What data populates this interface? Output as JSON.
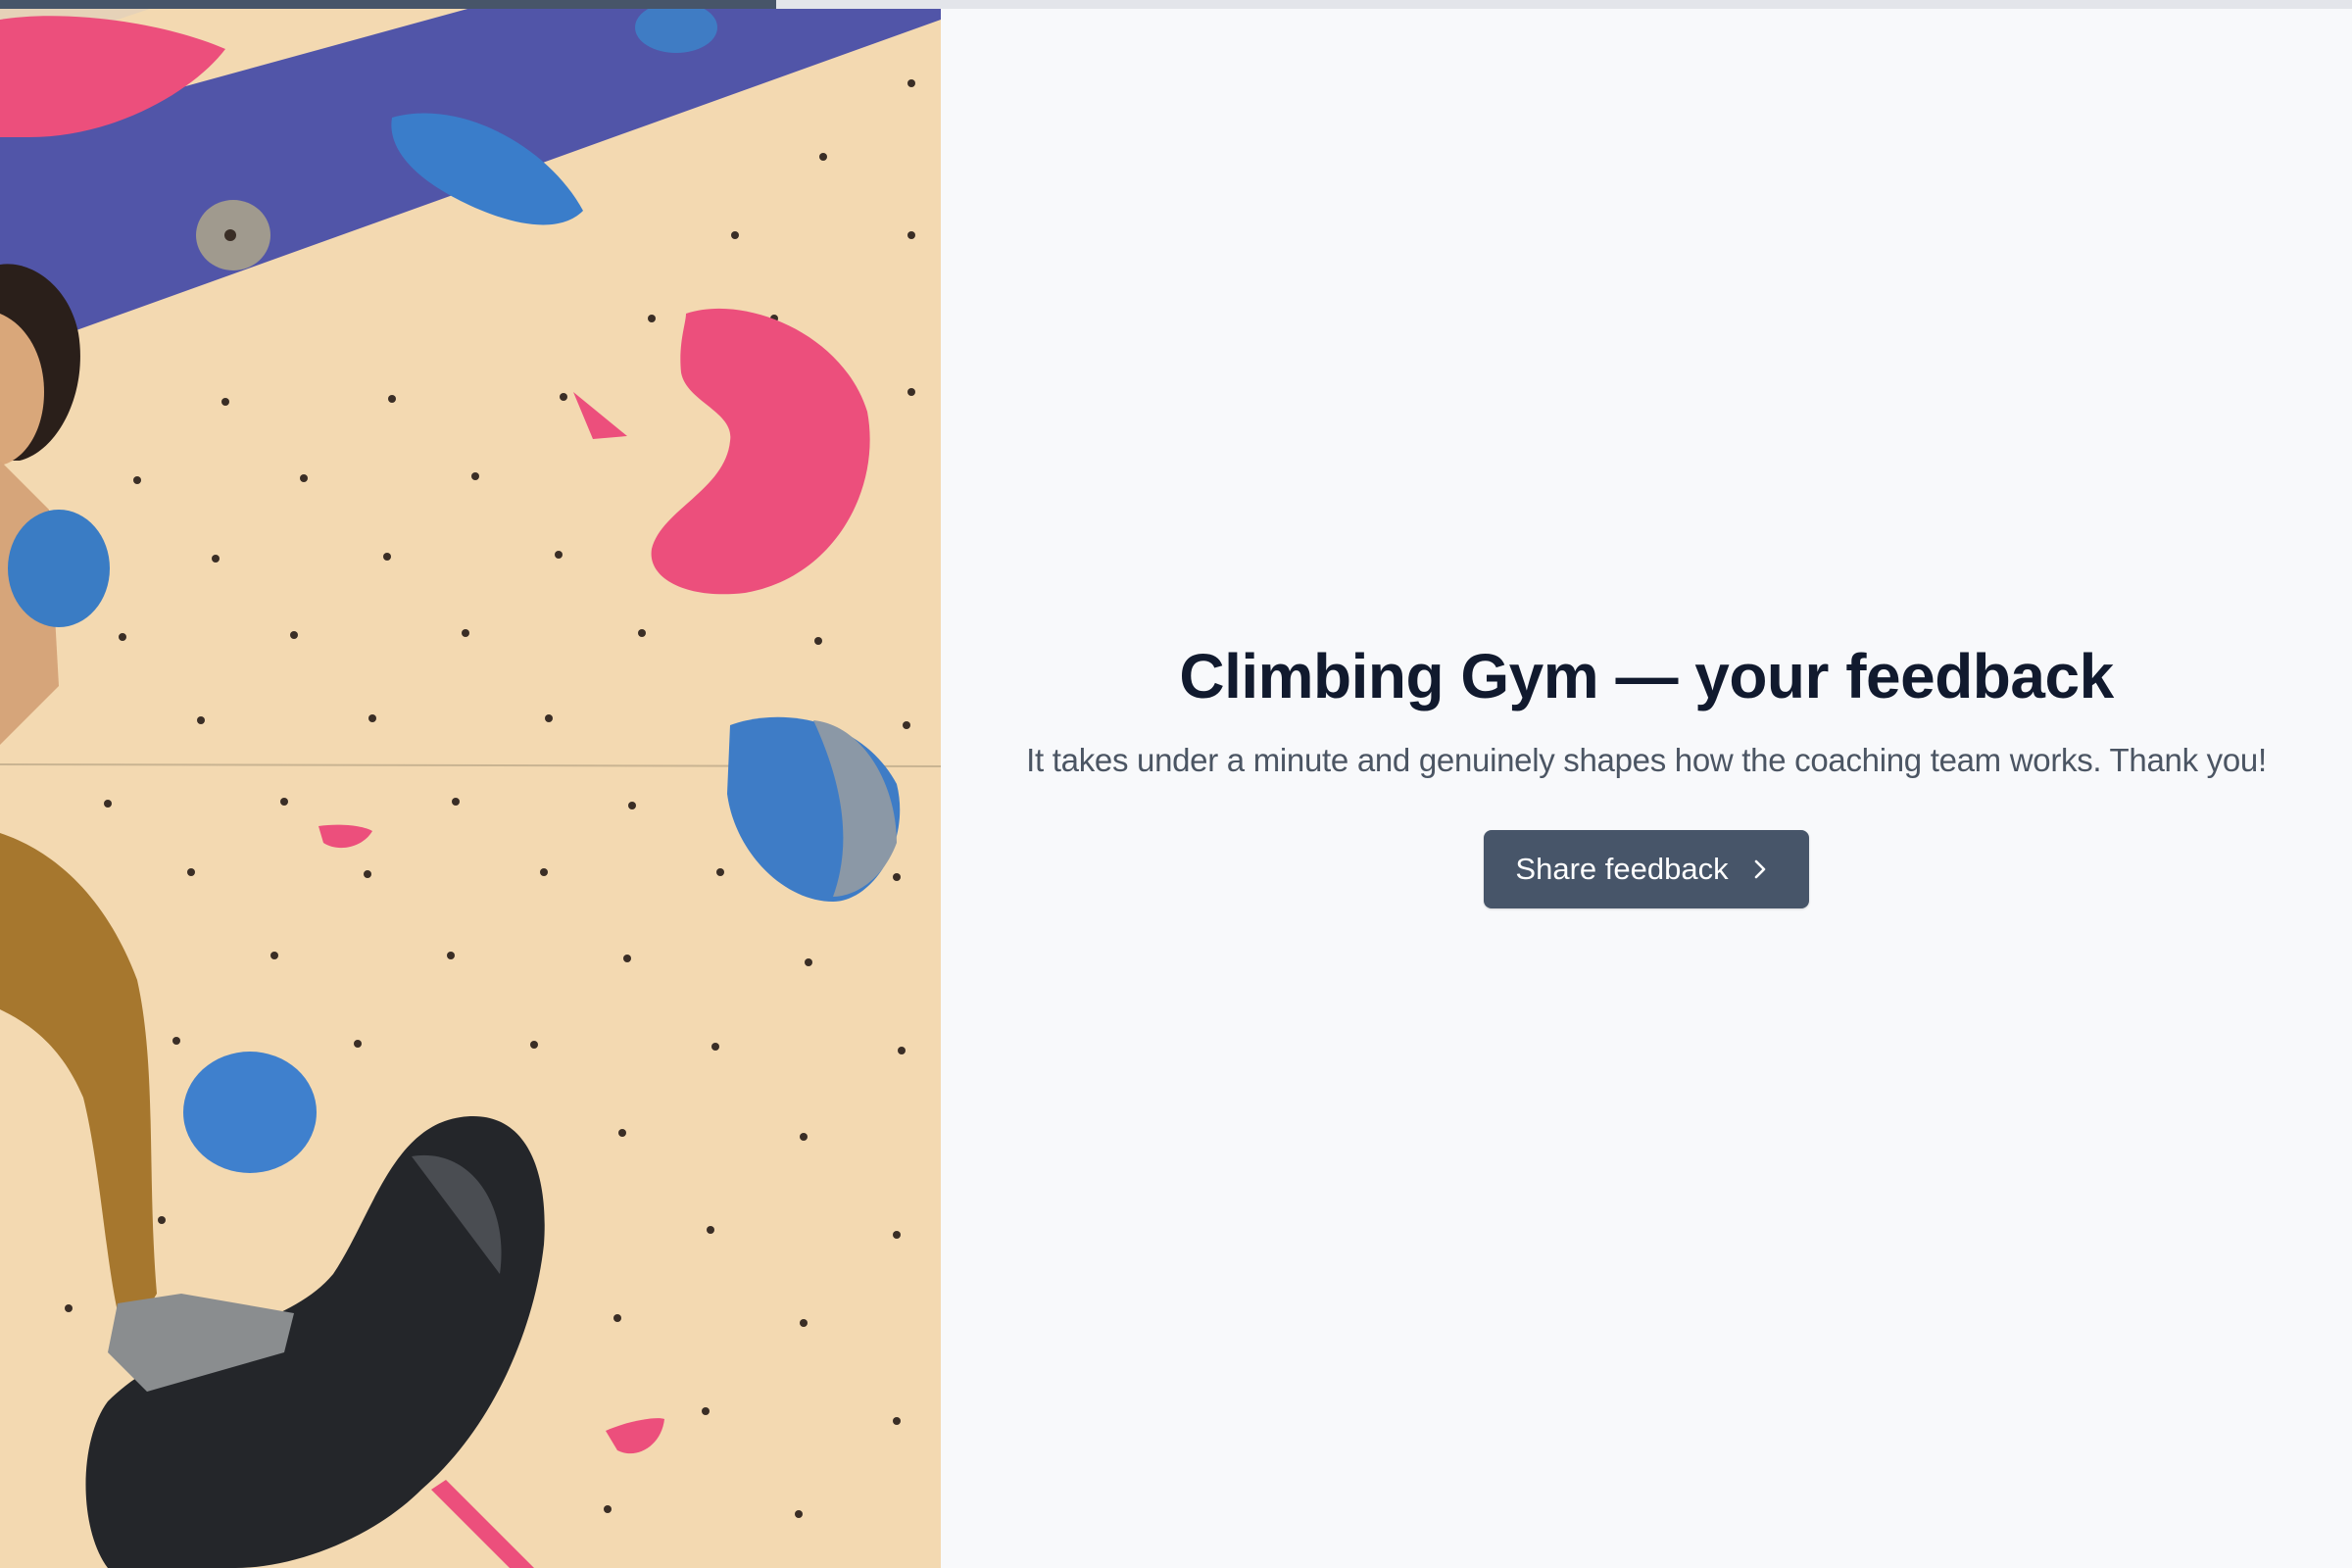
{
  "progress": {
    "fraction": 0.33,
    "colors": {
      "fill": "#475569",
      "track": "#e3e5ea"
    }
  },
  "hero": {
    "icon": "climbing-wall-photo"
  },
  "main": {
    "title": "Climbing Gym — your feedback",
    "subtitle": "It takes under a minute and genuinely shapes how the coaching team works. Thank you!",
    "cta_label": "Share feedback",
    "cta_icon": "chevron-right-icon"
  },
  "colors": {
    "title": "#111a2e",
    "subtitle": "#4b5563",
    "button": "#475569",
    "background": "#f8f9fb"
  }
}
